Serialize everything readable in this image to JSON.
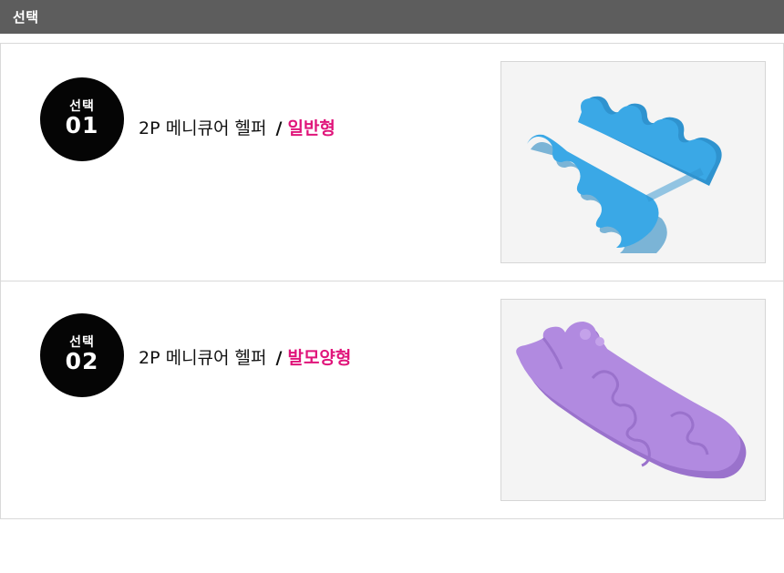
{
  "header": {
    "title": "선택"
  },
  "options": [
    {
      "badge_label": "선택",
      "badge_number": "01",
      "product_name": "2P 메니큐어 헬퍼",
      "separator": "/",
      "type": "일반형",
      "image_icon": "blue-toe-separator-image",
      "image_color": "#3aa8e6"
    },
    {
      "badge_label": "선택",
      "badge_number": "02",
      "product_name": "2P 메니큐어 헬퍼",
      "separator": "/",
      "type": "발모양형",
      "image_icon": "purple-foot-toe-separator-image",
      "image_color": "#b18ae0"
    }
  ],
  "colors": {
    "header_bg": "#5d5d5d",
    "accent": "#e0147a",
    "badge_bg": "#050505"
  }
}
